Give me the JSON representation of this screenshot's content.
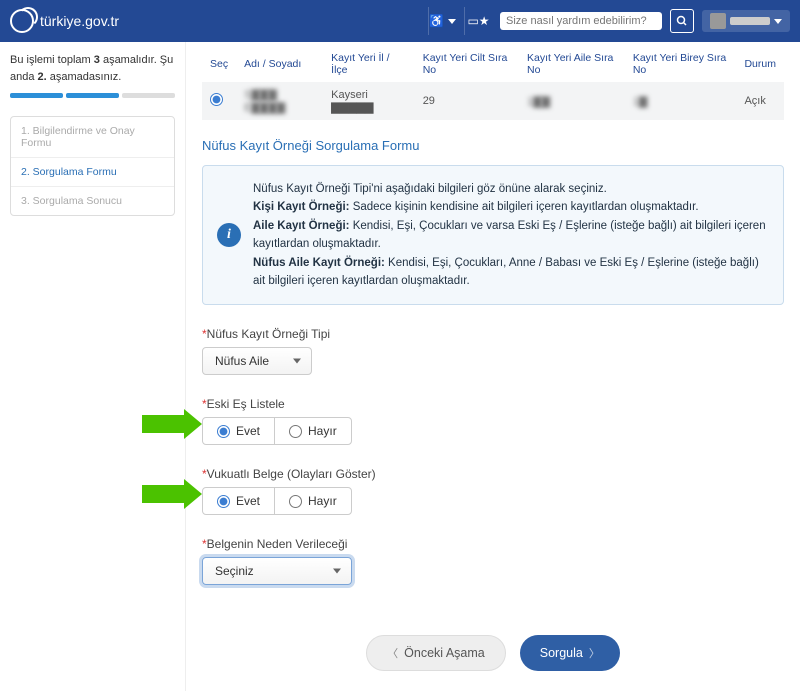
{
  "header": {
    "brand": "türkiye.gov.tr",
    "search_placeholder": "Size nasıl yardım edebilirim?"
  },
  "sidebar": {
    "status_html": "Bu işlemi toplam <b>3</b> aşamalıdır. Şu anda <b>2.</b> aşamadasınız.",
    "steps": [
      "1. Bilgilendirme ve Onay Formu",
      "2. Sorgulama Formu",
      "3. Sorgulama Sonucu"
    ]
  },
  "table": {
    "headers": [
      "Seç",
      "Adı / Soyadı",
      "Kayıt Yeri İl / İlçe",
      "Kayıt Yeri Cilt Sıra No",
      "Kayıt Yeri Aile Sıra No",
      "Kayıt Yeri Birey Sıra No",
      "Durum"
    ],
    "row": {
      "ad": "S▇▇▇ E▇▇▇▇",
      "il": "Kayseri ▇▇▇▇▇",
      "cilt": "29",
      "aile": "1▇▇",
      "birey": "1▇",
      "durum": "Açık"
    }
  },
  "form": {
    "title": "Nüfus Kayıt Örneği Sorgulama Formu",
    "info_primary": "Nüfus Kayıt Örneği Tipi'ni aşağıdaki bilgileri göz önüne alarak seçiniz.",
    "info_kisi_b": "Kişi Kayıt Örneği:",
    "info_kisi": " Sadece kişinin kendisine ait bilgileri içeren kayıtlardan oluşmaktadır.",
    "info_aile_b": "Aile Kayıt Örneği:",
    "info_aile": " Kendisi, Eşi, Çocukları ve varsa Eski Eş / Eşlerine (isteğe bağlı) ait bilgileri içeren kayıtlardan oluşmaktadır.",
    "info_nufus_b": "Nüfus Aile Kayıt Örneği:",
    "info_nufus": " Kendisi, Eşi, Çocukları, Anne / Babası ve Eski Eş / Eşlerine (isteğe bağlı) ait bilgileri içeren kayıtlardan oluşmaktadır.",
    "field_tip_label": "Nüfus Kayıt Örneği Tipi",
    "field_tip_value": "Nüfus Aile",
    "field_eski_label": "Eski Eş Listele",
    "field_vukuatli_label": "Vukuatlı Belge (Olayları Göster)",
    "field_neden_label": "Belgenin Neden Verileceği",
    "field_neden_value": "Seçiniz",
    "opt_evet": "Evet",
    "opt_hayir": "Hayır",
    "btn_prev": "Önceki Aşama",
    "btn_submit": "Sorgula"
  }
}
